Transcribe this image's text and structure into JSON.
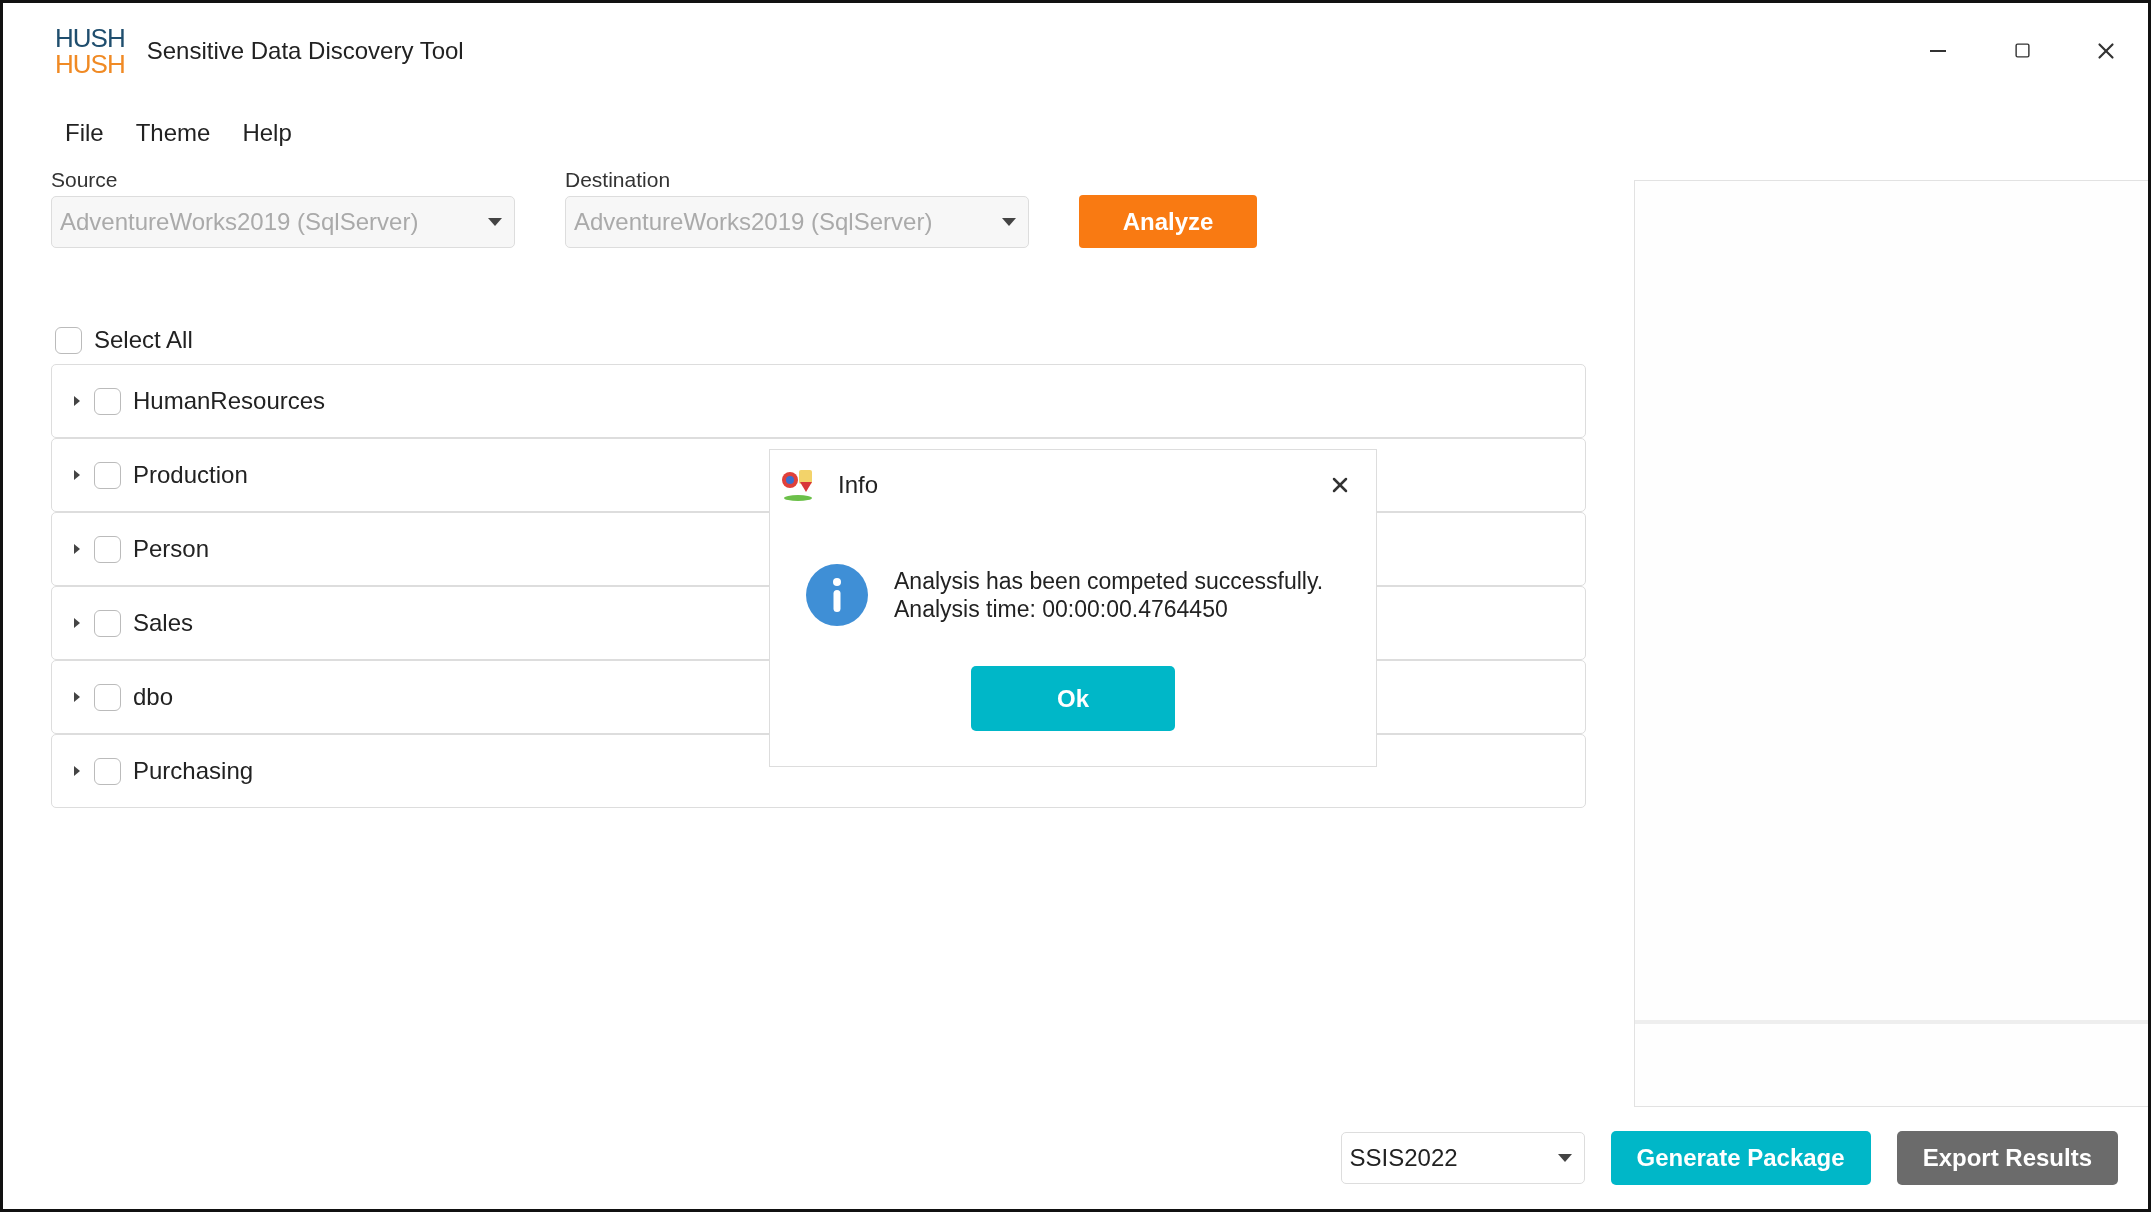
{
  "window": {
    "logo": {
      "top": "HUSH",
      "bottom": "HUSH"
    },
    "title": "Sensitive Data Discovery Tool"
  },
  "menu": [
    "File",
    "Theme",
    "Help"
  ],
  "source": {
    "label": "Source",
    "value": "AdventureWorks2019 (SqlServer)",
    "disabled": true
  },
  "destination": {
    "label": "Destination",
    "value": "AdventureWorks2019 (SqlServer)",
    "disabled": true
  },
  "analyze_button": "Analyze",
  "select_all": {
    "label": "Select All",
    "checked": false
  },
  "tree": [
    {
      "label": "HumanResources",
      "checked": false,
      "expanded": false
    },
    {
      "label": "Production",
      "checked": false,
      "expanded": false
    },
    {
      "label": "Person",
      "checked": false,
      "expanded": false
    },
    {
      "label": "Sales",
      "checked": false,
      "expanded": false
    },
    {
      "label": "dbo",
      "checked": false,
      "expanded": false
    },
    {
      "label": "Purchasing",
      "checked": false,
      "expanded": false
    }
  ],
  "package_version": {
    "value": "SSIS2022",
    "disabled": false
  },
  "buttons": [
    {
      "label": "Generate Package",
      "kind": "primary"
    },
    {
      "label": "Export Results",
      "kind": "secondary"
    }
  ],
  "dialog": {
    "title": "Info",
    "message": "Analysis has been competed successfully.",
    "detail": "Analysis time: 00:00:00.4764450",
    "button": "Ok"
  }
}
